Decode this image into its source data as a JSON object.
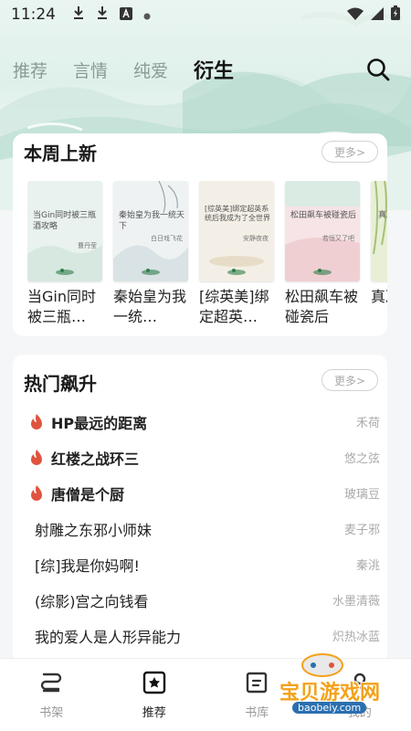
{
  "status_bar": {
    "time": "11:24"
  },
  "tabs": [
    {
      "label": "推荐"
    },
    {
      "label": "言情"
    },
    {
      "label": "纯爱"
    },
    {
      "label": "衍生"
    }
  ],
  "new_this_week": {
    "title": "本周上新",
    "more_label": "更多>",
    "books": [
      {
        "title": "当Gin同时被三瓶…",
        "cover_text": "当Gin同时被三瓶酒攻略",
        "cover_author": "曹丹莹",
        "cover_color": "#e9f2ee"
      },
      {
        "title": "秦始皇为我一统…",
        "cover_text": "秦始皇为我一统天下",
        "cover_author": "白日戏飞花",
        "cover_color": "#eef2f3"
      },
      {
        "title": "[综英美]绑定超英…",
        "cover_text": "[综英美]绑定超英系统后我成为了全世界",
        "cover_author": "安静夜夜",
        "cover_color": "#f3efe6"
      },
      {
        "title": "松田飙车被碰瓷后",
        "cover_text": "松田飙车被碰瓷后",
        "cover_author": "若恒又了吧",
        "cover_color": "#f6e4e6"
      },
      {
        "title": "真决强泼",
        "cover_text": "真决",
        "cover_author": "",
        "cover_color": "#e7f0d6"
      }
    ]
  },
  "hot_rising": {
    "title": "热门飙升",
    "more_label": "更多>",
    "items": [
      {
        "title": "HP最远的距离",
        "author": "禾荷",
        "hot": true
      },
      {
        "title": "红楼之战环三",
        "author": "悠之弦",
        "hot": true
      },
      {
        "title": "唐僧是个厨",
        "author": "玻璃豆",
        "hot": true
      },
      {
        "title": "射雕之东邪小师妹",
        "author": "麦子邪",
        "hot": false
      },
      {
        "title": "[综]我是你妈啊!",
        "author": "秦洮",
        "hot": false
      },
      {
        "title": "(综影)宫之向钱看",
        "author": "水墨清薇",
        "hot": false
      },
      {
        "title": "我的爱人是人形异能力",
        "author": "炽热冰蓝",
        "hot": false
      }
    ]
  },
  "bottom_nav": [
    {
      "label": "书架"
    },
    {
      "label": "推荐"
    },
    {
      "label": "书库"
    },
    {
      "label": "我的"
    }
  ],
  "watermark": {
    "text": "宝贝游戏网",
    "url": "baobeiy.com"
  },
  "colors": {
    "flame": "#e0533f",
    "active_tab": "#111111",
    "inactive_tab": "#8a9a96"
  }
}
